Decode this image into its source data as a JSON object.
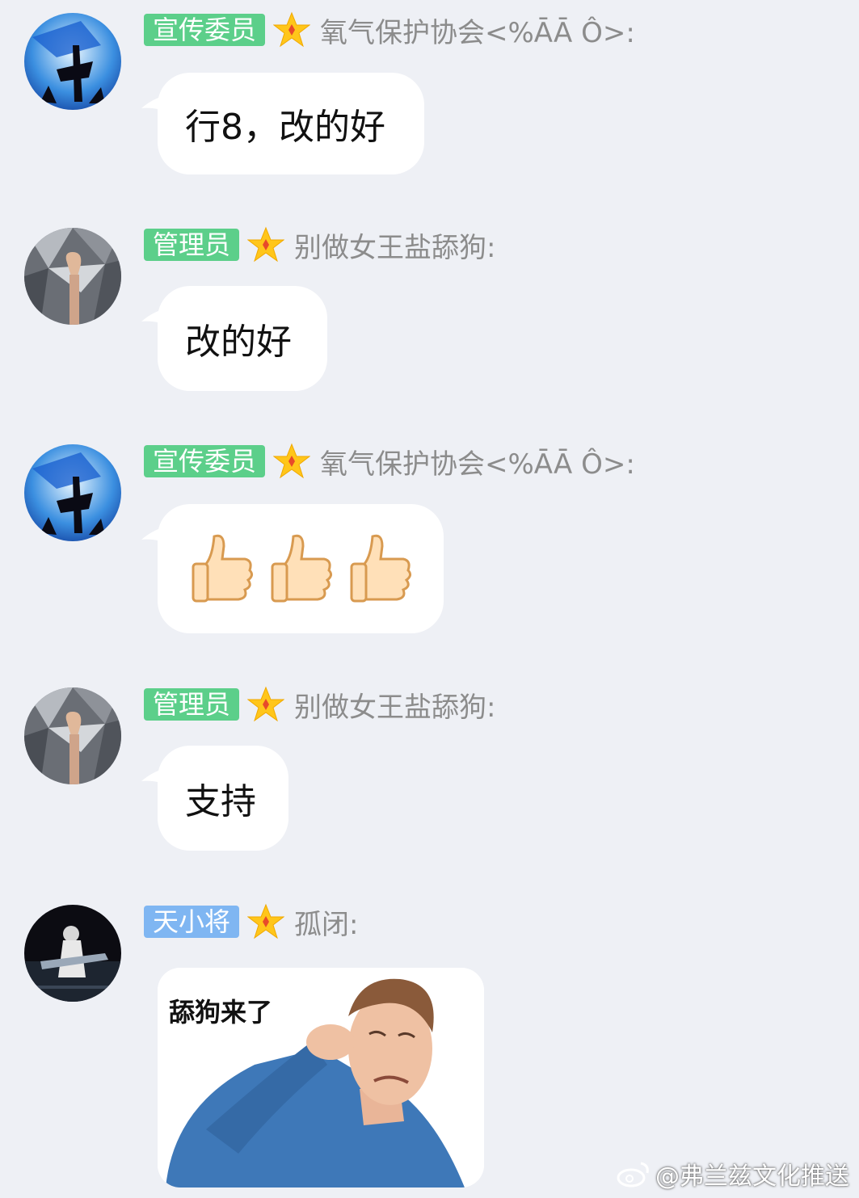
{
  "colors": {
    "background": "#eef0f5",
    "badge_green": "#5ccf8a",
    "badge_blue": "#7fb6f2",
    "sender_gray": "#8c8c8c",
    "star_yellow": "#ffc61a"
  },
  "messages": [
    {
      "avatar": "blue-flag-avatar",
      "badge": "宣传委员",
      "badge_color": "#5ccf8a",
      "sender": "氧气保护协会<%ĀĀ Ô>:",
      "text": "行8，改的好",
      "type": "text"
    },
    {
      "avatar": "fist-avatar",
      "badge": "管理员",
      "badge_color": "#5ccf8a",
      "sender": "别做女王盐舔狗:",
      "text": "改的好",
      "type": "text"
    },
    {
      "avatar": "blue-flag-avatar",
      "badge": "宣传委员",
      "badge_color": "#5ccf8a",
      "sender": "氧气保护协会<%ĀĀ Ô>:",
      "emoji": [
        "thumbs-up-icon",
        "thumbs-up-icon",
        "thumbs-up-icon"
      ],
      "type": "emoji"
    },
    {
      "avatar": "fist-avatar",
      "badge": "管理员",
      "badge_color": "#5ccf8a",
      "sender": "别做女王盐舔狗:",
      "text": "支持",
      "type": "text"
    },
    {
      "avatar": "dark-girl-avatar",
      "badge": "天小将",
      "badge_color": "#7fb6f2",
      "sender": "孤闭:",
      "sticker_caption": "舔狗来了",
      "type": "sticker"
    }
  ],
  "watermark": {
    "icon": "weibo-icon",
    "text": "@弗兰兹文化推送"
  }
}
